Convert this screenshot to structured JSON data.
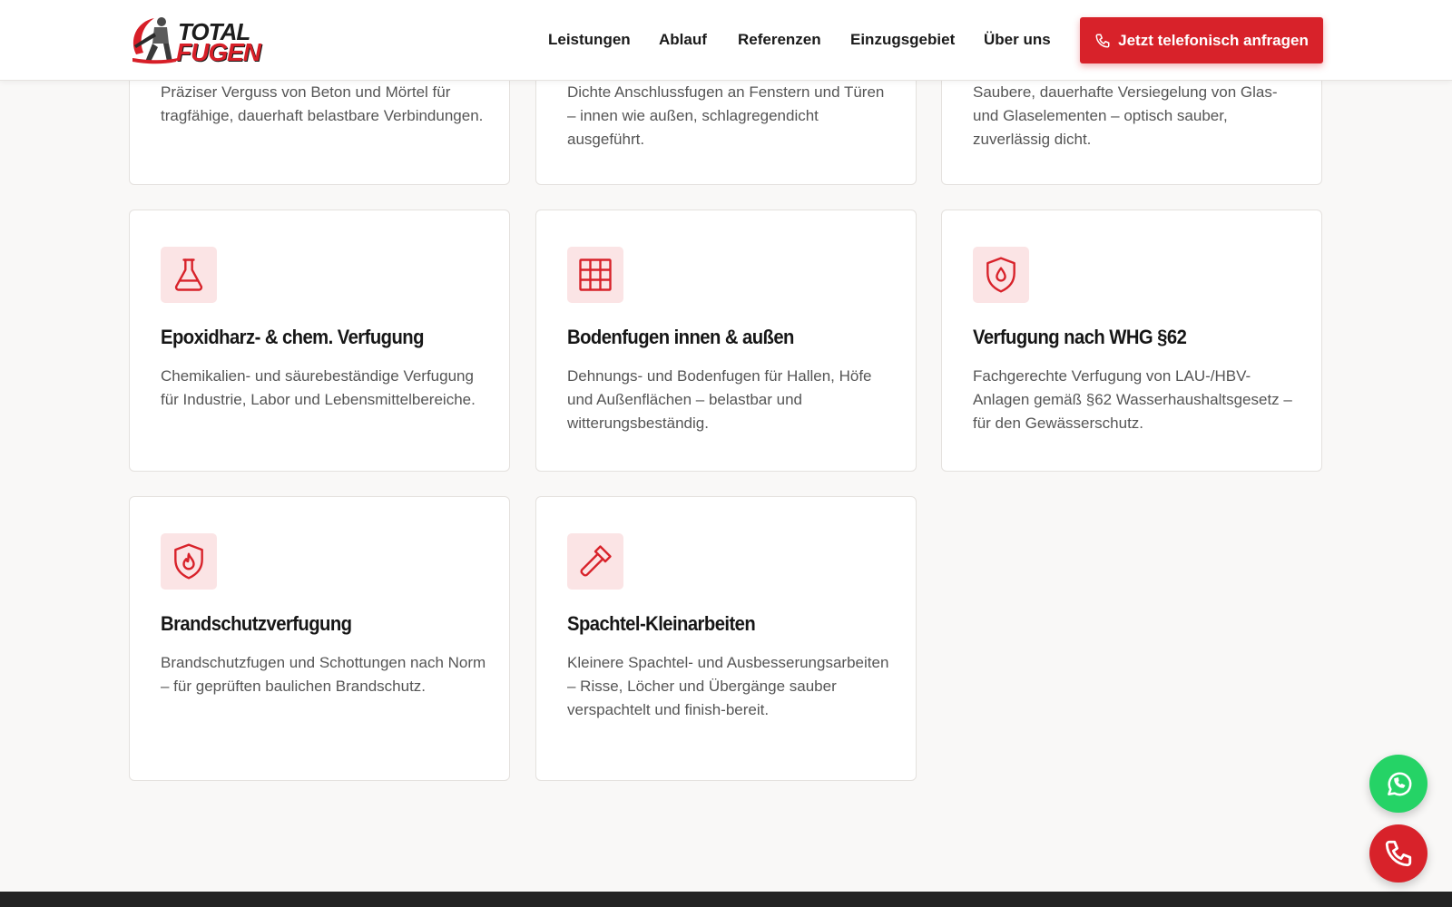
{
  "brand": {
    "logo_line1": "TOTAL",
    "logo_line2": "FUGEN",
    "accent": "#d8222a",
    "icon_bg": "#fbe4e5"
  },
  "nav": {
    "items": [
      "Leistungen",
      "Ablauf",
      "Referenzen",
      "Einzugsgebiet",
      "Über uns"
    ],
    "cta_label": "Jetzt telefonisch anfragen",
    "cta_icon": "phone-icon"
  },
  "cards_partial": [
    {
      "text": "Präziser Verguss von Beton und Mörtel für tragfähige, dauerhaft belastbare Verbindungen."
    },
    {
      "text": "Dichte Anschlussfugen an Fenstern und Türen – innen wie außen, schlagregendicht ausgeführt."
    },
    {
      "text": "Saubere, dauerhafte Versiegelung von Glas- und Glaselementen – optisch sauber, zuverlässig dicht."
    }
  ],
  "cards": [
    {
      "icon": "flask-icon",
      "title": "Epoxidharz- & chem. Verfugung",
      "text": "Chemikalien- und säurebeständige Verfugung für Industrie, Labor und Lebensmittelbereiche."
    },
    {
      "icon": "grid-icon",
      "title": "Bodenfugen innen & außen",
      "text": "Dehnungs- und Bodenfugen für Hallen, Höfe und Außenflächen – belastbar und witterungsbeständig."
    },
    {
      "icon": "shield-drop-icon",
      "title": "Verfugung nach WHG §62",
      "text": "Fachgerechte Verfugung von LAU-/HBV-Anlagen gemäß §62 Wasserhaushaltsgesetz – für den Gewässerschutz."
    },
    {
      "icon": "shield-flame-icon",
      "title": "Brandschutzverfugung",
      "text": "Brandschutzfugen und Schottungen nach Norm – für geprüften baulichen Brandschutz."
    },
    {
      "icon": "hammer-icon",
      "title": "Spachtel-Kleinarbeiten",
      "text": "Kleinere Spachtel- und Ausbesserungsarbeiten – Risse, Löcher und Übergänge sauber verspachtelt und finish-bereit."
    }
  ],
  "floating": {
    "whatsapp_icon": "whatsapp-icon",
    "call_icon": "phone-icon",
    "whatsapp_color": "#25d366"
  }
}
